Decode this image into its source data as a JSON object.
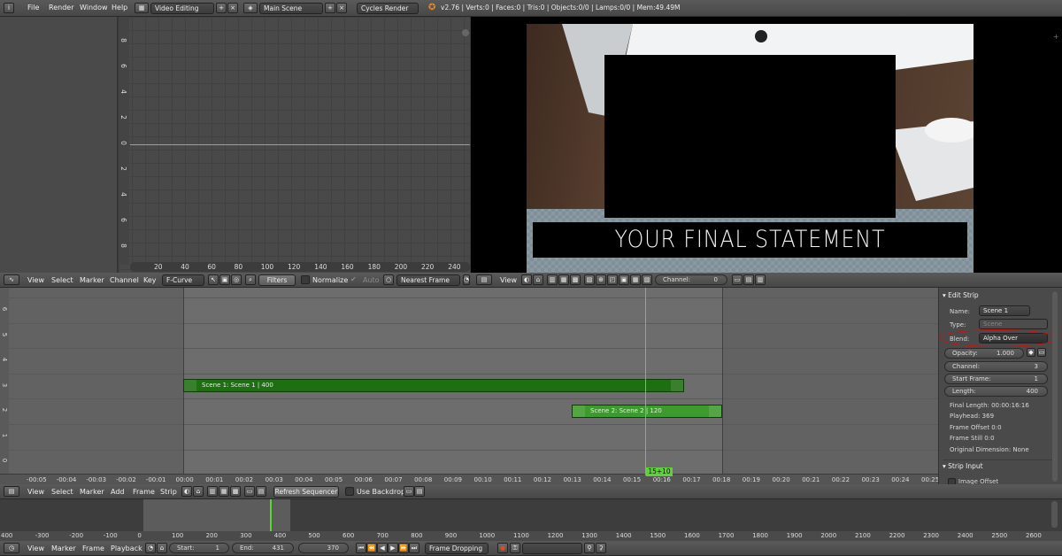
{
  "top_bar": {
    "menus": [
      "File",
      "Render",
      "Window",
      "Help"
    ],
    "screen_layout": "Video Editing",
    "scene": "Main Scene",
    "render_engine": "Cycles Render",
    "stats": "v2.76 | Verts:0 | Faces:0 | Tris:0 | Objects:0/0 | Lamps:0/0 | Mem:49.49M"
  },
  "graph_editor": {
    "x_ticks": [
      "20",
      "40",
      "60",
      "80",
      "100",
      "120",
      "140",
      "160",
      "180",
      "200",
      "220",
      "240"
    ],
    "y_ticks": [
      "8",
      "6",
      "4",
      "2",
      "0",
      "2",
      "4",
      "6",
      "8"
    ],
    "header": {
      "menus": [
        "View",
        "Select",
        "Marker",
        "Channel",
        "Key"
      ],
      "mode": "F-Curve",
      "filters": "Filters",
      "normalize": "Normalize",
      "auto": "Auto",
      "snap": "Nearest Frame"
    }
  },
  "preview": {
    "caption": "YOUR FINAL STATEMENT",
    "header": {
      "view": "View",
      "channel_label": "Channel:",
      "channel_value": "0"
    }
  },
  "sequencer": {
    "channel_ticks": [
      "6",
      "5",
      "4",
      "3",
      "2",
      "1",
      "0"
    ],
    "time_ticks": [
      "-00:05",
      "-00:04",
      "-00:03",
      "-00:02",
      "-00:01",
      "00:00",
      "00:01",
      "00:02",
      "00:03",
      "00:04",
      "00:05",
      "00:06",
      "00:07",
      "00:08",
      "00:09",
      "00:10",
      "00:11",
      "00:12",
      "00:13",
      "00:14",
      "00:15",
      "00:16",
      "00:17",
      "00:18",
      "00:19",
      "00:20",
      "00:21",
      "00:22",
      "00:23",
      "00:24",
      "00:25"
    ],
    "playhead_label": "15+10",
    "strips": [
      {
        "label": "Scene 1: Scene 1 | 400",
        "color": "#1e6e12"
      },
      {
        "label": "Scene 2: Scene 2 | 120",
        "color": "#3d9a2c"
      }
    ],
    "header": {
      "menus": [
        "View",
        "Select",
        "Marker",
        "Add",
        "Frame",
        "Strip"
      ],
      "refresh": "Refresh Sequencer",
      "use_backdrop": "Use Backdrop"
    }
  },
  "properties": {
    "edit_strip_title": "Edit Strip",
    "name_label": "Name:",
    "name_value": "Scene 1",
    "type_label": "Type:",
    "type_value": "Scene",
    "blend_label": "Blend:",
    "blend_value": "Alpha Over",
    "opacity_label": "Opacity:",
    "opacity_value": "1.000",
    "channel_label": "Channel:",
    "channel_value": "3",
    "start_label": "Start Frame:",
    "start_value": "1",
    "length_label": "Length:",
    "length_value": "400",
    "final_length": "Final Length: 00:00:16:16",
    "playhead": "Playhead: 369",
    "frame_offset": "Frame Offset 0:0",
    "frame_still": "Frame Still 0:0",
    "original_dimension": "Original Dimension: None",
    "strip_input_title": "Strip Input",
    "image_offset": "Image Offset"
  },
  "timeline": {
    "ticks": [
      "400",
      "-300",
      "-200",
      "-100",
      "0",
      "100",
      "200",
      "300",
      "400",
      "500",
      "600",
      "700",
      "800",
      "900",
      "1000",
      "1100",
      "1200",
      "1300",
      "1400",
      "1500",
      "1600",
      "1700",
      "1800",
      "1900",
      "2000",
      "2100",
      "2200",
      "2300",
      "2400",
      "2500",
      "2600"
    ],
    "header": {
      "menus": [
        "View",
        "Marker",
        "Frame",
        "Playback"
      ],
      "start_label": "Start:",
      "start_value": "1",
      "end_label": "End:",
      "end_value": "431",
      "current_frame": "370",
      "sync": "Frame Dropping"
    }
  },
  "colors": {
    "accent_green": "#5fd23a",
    "highlight_red": "#d01010"
  }
}
